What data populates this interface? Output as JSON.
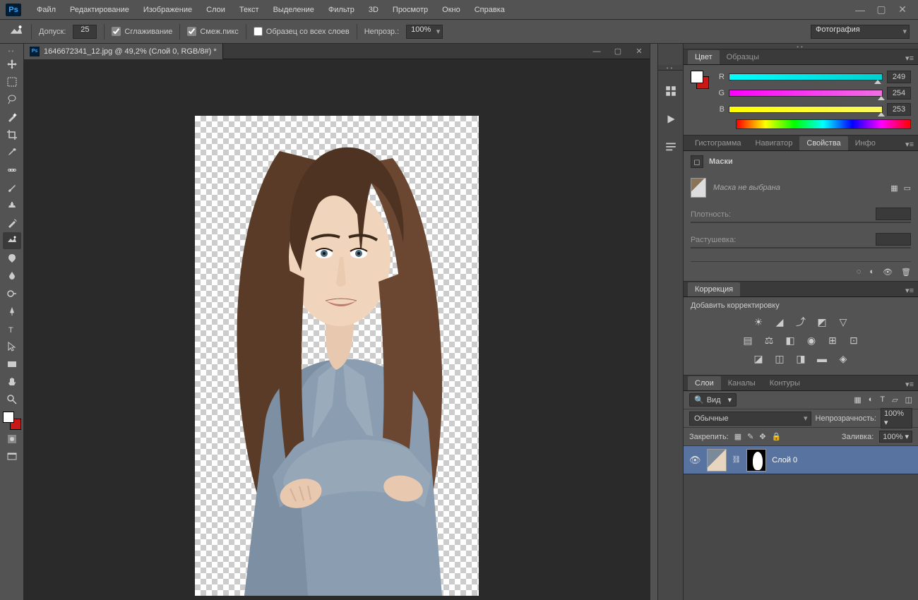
{
  "app": {
    "logo": "Ps"
  },
  "menubar": [
    "Файл",
    "Редактирование",
    "Изображение",
    "Слои",
    "Текст",
    "Выделение",
    "Фильтр",
    "3D",
    "Просмотр",
    "Окно",
    "Справка"
  ],
  "options": {
    "tolerance_label": "Допуск:",
    "tolerance_value": "25",
    "antialias": "Сглаживание",
    "contiguous": "Смеж.пикс",
    "all_layers": "Образец со всех слоев",
    "opacity_label": "Непрозр.:",
    "opacity_value": "100%",
    "workspace": "Фотография"
  },
  "document": {
    "title": "1646672341_12.jpg @ 49,2% (Слой 0, RGB/8#) *"
  },
  "panels": {
    "color": {
      "tabs": [
        "Цвет",
        "Образцы"
      ],
      "r": "249",
      "g": "254",
      "b": "253",
      "labels": {
        "r": "R",
        "g": "G",
        "b": "B"
      }
    },
    "nav_tabs": [
      "Гистограмма",
      "Навигатор",
      "Свойства",
      "Инфо"
    ],
    "props": {
      "title": "Маски",
      "no_mask": "Маска не выбрана",
      "density": "Плотность:",
      "feather": "Растушевка:"
    },
    "adj": {
      "tab": "Коррекция",
      "title": "Добавить корректировку"
    },
    "layers": {
      "tabs": [
        "Слои",
        "Каналы",
        "Контуры"
      ],
      "kind": "Вид",
      "blend": "Обычные",
      "opacity_label": "Непрозрачность:",
      "opacity": "100%",
      "lock_label": "Закрепить:",
      "fill_label": "Заливка:",
      "fill": "100%",
      "layer0": "Слой 0"
    }
  }
}
